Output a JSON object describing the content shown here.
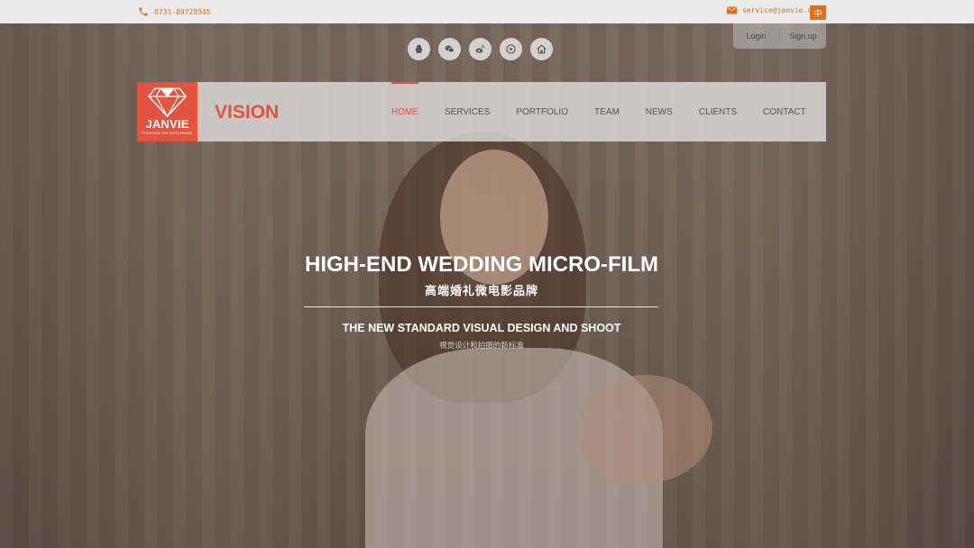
{
  "topbar": {
    "phone": "0731-89728345",
    "email": "service@janvie.com",
    "lang": "中"
  },
  "auth": {
    "login": "Login",
    "signup": "Sign up"
  },
  "social": [
    "qq-icon",
    "wechat-icon",
    "weibo-icon",
    "video-icon",
    "home-icon"
  ],
  "logo": {
    "name": "JANVIE",
    "tagline": "CREATING THE DIFFERENCE"
  },
  "brand": "VISION",
  "menu": [
    "HOME",
    "SERVICES",
    "PORTFOLIO",
    "TEAM",
    "NEWS",
    "CLIENTS",
    "CONTACT"
  ],
  "hero": {
    "title": "HIGH-END WEDDING MICRO-FILM",
    "title_cn": "高端婚礼微电影品牌",
    "subtitle": "THE NEW STANDARD VISUAL DESIGN AND SHOOT",
    "subtitle_cn": "视觉设计和拍摄的新标准"
  },
  "colors": {
    "accent": "#e0701e",
    "brand": "#e4533e"
  }
}
